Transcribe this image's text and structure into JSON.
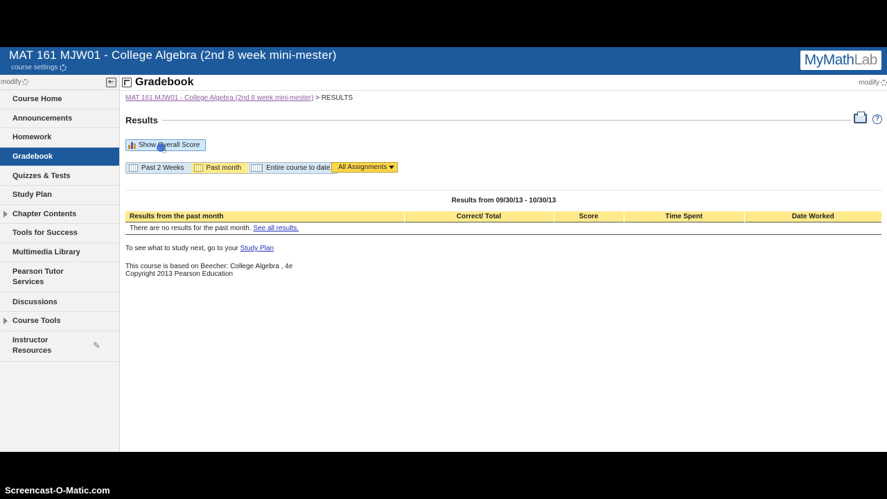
{
  "header": {
    "course_title": "MAT 161 MJW01 - College Algebra (2nd 8 week mini-mester)",
    "course_settings": "course settings",
    "logo_main": "MyMath",
    "logo_accent": "Lab",
    "brand_color": "#1c5a9c"
  },
  "sidebar": {
    "modify": "modify",
    "collapse_icon": "collapse-panel-icon",
    "items": [
      {
        "label": "Course Home"
      },
      {
        "label": "Announcements"
      },
      {
        "label": "Homework"
      },
      {
        "label": "Gradebook",
        "active": true
      },
      {
        "label": "Quizzes & Tests"
      },
      {
        "label": "Study Plan"
      },
      {
        "label": "Chapter Contents",
        "expandable": true
      },
      {
        "label": "Tools for Success"
      },
      {
        "label": "Multimedia Library"
      },
      {
        "label": "Pearson Tutor Services"
      },
      {
        "label": "Discussions"
      },
      {
        "label": "Course Tools",
        "expandable": true
      },
      {
        "label": "Instructor Resources"
      }
    ]
  },
  "main": {
    "title": "Gradebook",
    "modify": "modify",
    "breadcrumb": {
      "link": "MAT 161 MJW01 - College Algebra (2nd 8 week mini-mester)",
      "separator": ">",
      "current": "RESULTS"
    },
    "results_heading": "Results",
    "show_overall_label": "Show Overall Score",
    "timeframes": [
      "Past 2 Weeks",
      "Past month",
      "Entire course to date"
    ],
    "selected_timeframe": "Past month",
    "assignment_filter": "All Assignments",
    "range_text": "Results from 09/30/13 - 10/30/13",
    "table": {
      "headers": [
        "Results from the past month",
        "Correct/ Total",
        "Score",
        "Time Spent",
        "Date Worked"
      ],
      "empty_text": "There are no results for the past month.",
      "see_all": "See all results."
    },
    "study_next_text": "To see what to study next, go to your",
    "study_plan_link": "Study Plan",
    "based_on": "This course is based on Beecher: College Algebra , 4e",
    "copyright": "Copyright 2013 Pearson Education"
  },
  "watermark": "Screencast-O-Matic.com"
}
